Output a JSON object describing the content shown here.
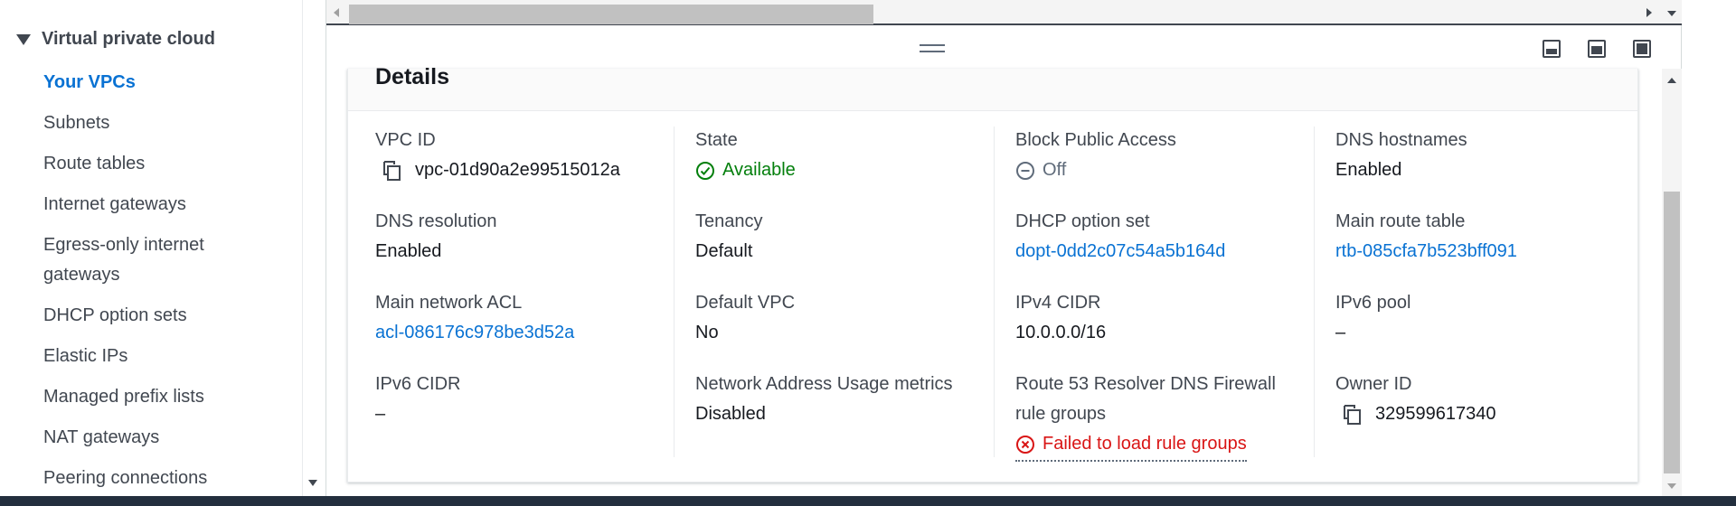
{
  "sidebar": {
    "section_title": "Virtual private cloud",
    "items": [
      {
        "label": "Your VPCs"
      },
      {
        "label": "Subnets"
      },
      {
        "label": "Route tables"
      },
      {
        "label": "Internet gateways"
      },
      {
        "label": "Egress-only internet gateways"
      },
      {
        "label": "DHCP option sets"
      },
      {
        "label": "Elastic IPs"
      },
      {
        "label": "Managed prefix lists"
      },
      {
        "label": "NAT gateways"
      },
      {
        "label": "Peering connections"
      }
    ]
  },
  "details": {
    "title": "Details",
    "vpc_id": {
      "label": "VPC ID",
      "value": "vpc-01d90a2e99515012a"
    },
    "state": {
      "label": "State",
      "value": "Available"
    },
    "block_public_access": {
      "label": "Block Public Access",
      "value": "Off"
    },
    "dns_hostnames": {
      "label": "DNS hostnames",
      "value": "Enabled"
    },
    "dns_resolution": {
      "label": "DNS resolution",
      "value": "Enabled"
    },
    "tenancy": {
      "label": "Tenancy",
      "value": "Default"
    },
    "dhcp_option_set": {
      "label": "DHCP option set",
      "value": "dopt-0dd2c07c54a5b164d"
    },
    "main_route_table": {
      "label": "Main route table",
      "value": "rtb-085cfa7b523bff091"
    },
    "main_network_acl": {
      "label": "Main network ACL",
      "value": "acl-086176c978be3d52a"
    },
    "default_vpc": {
      "label": "Default VPC",
      "value": "No"
    },
    "ipv4_cidr": {
      "label": "IPv4 CIDR",
      "value": "10.0.0.0/16"
    },
    "ipv6_pool": {
      "label": "IPv6 pool",
      "value": "–"
    },
    "ipv6_cidr": {
      "label": "IPv6 CIDR",
      "value": "–"
    },
    "network_address_usage": {
      "label": "Network Address Usage metrics",
      "value": "Disabled"
    },
    "route53_firewall": {
      "label": "Route 53 Resolver DNS Firewall rule groups",
      "value": "Failed to load rule groups"
    },
    "owner_id": {
      "label": "Owner ID",
      "value": "329599617340"
    }
  },
  "colors": {
    "link": "#0972d3",
    "success": "#037f0c",
    "error": "#d91515",
    "text": "#16191f",
    "label": "#414750"
  },
  "icons": {
    "copy": "copy-icon",
    "status_ok": "check-circle-icon",
    "status_off": "minus-circle-icon",
    "status_error": "x-circle-icon"
  }
}
